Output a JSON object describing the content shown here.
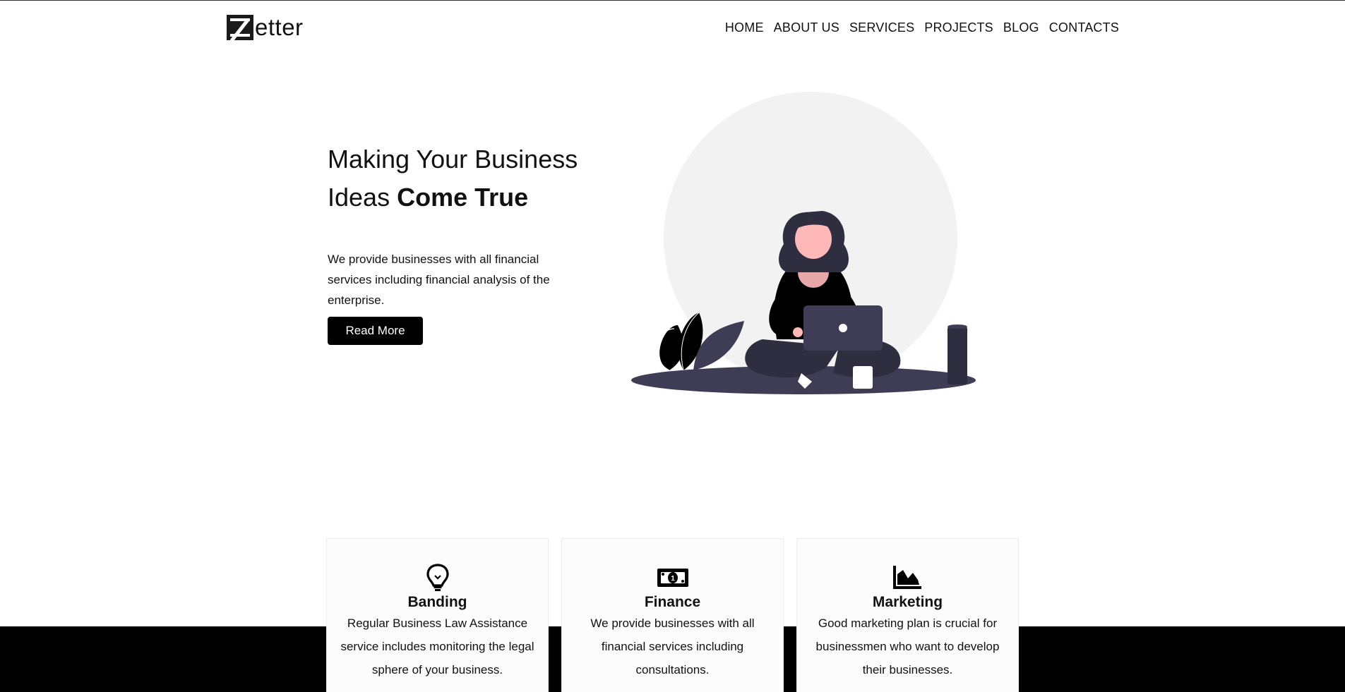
{
  "brand": {
    "logo_text": "etter"
  },
  "nav": {
    "items": [
      "HOME",
      "ABOUT US",
      "SERVICES",
      "PROJECTS",
      "BLOG",
      "CONTACTS"
    ]
  },
  "hero": {
    "title_regular": "Making Your Business Ideas ",
    "title_bold": "Come True",
    "description": "We provide businesses with all financial services including financial analysis of the enterprise.",
    "cta_label": "Read More",
    "illustration": "woman-with-laptop-illustration"
  },
  "services": [
    {
      "icon": "lightbulb-icon",
      "title": "Banding",
      "description": "Regular Business Law Assistance service includes monitoring the legal sphere of your business."
    },
    {
      "icon": "money-bill-icon",
      "title": "Finance",
      "description": "We provide businesses with all financial services including consultations."
    },
    {
      "icon": "area-chart-icon",
      "title": "Marketing",
      "description": "Good marketing plan is crucial for businessmen who want to develop their businesses."
    }
  ],
  "colors": {
    "accent": "#000000",
    "background": "#ffffff",
    "illustration_dark": "#3f3d56",
    "illustration_skin": "#ffb8b8",
    "circle": "#f2f2f2"
  }
}
